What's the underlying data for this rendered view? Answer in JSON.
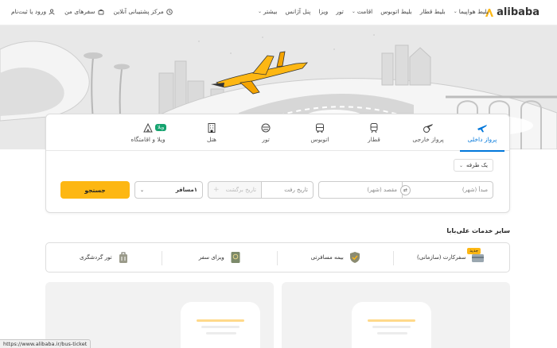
{
  "header": {
    "brand": "alibaba",
    "nav": [
      {
        "label": "بلیط هواپیما",
        "dropdown": true
      },
      {
        "label": "بلیط قطار",
        "dropdown": false
      },
      {
        "label": "بلیط اتوبوس",
        "dropdown": false
      },
      {
        "label": "اقامت",
        "dropdown": true
      },
      {
        "label": "تور",
        "dropdown": false
      },
      {
        "label": "ویزا",
        "dropdown": false
      },
      {
        "label": "پنل آژانس",
        "dropdown": false
      },
      {
        "label": "بیشتر",
        "dropdown": true
      }
    ],
    "support": "مرکز پشتیبانی آنلاین",
    "my_trips": "سفرهای من",
    "login": "ورود یا ثبت‌نام"
  },
  "tabs": [
    {
      "label": "پرواز داخلی",
      "icon": "plane-icon",
      "active": true
    },
    {
      "label": "پرواز خارجی",
      "icon": "globe-plane-icon",
      "active": false
    },
    {
      "label": "قطار",
      "icon": "train-icon",
      "active": false
    },
    {
      "label": "اتوبوس",
      "icon": "bus-icon",
      "active": false
    },
    {
      "label": "تور",
      "icon": "tour-icon",
      "active": false
    },
    {
      "label": "هتل",
      "icon": "hotel-icon",
      "active": false
    },
    {
      "label": "ویلا و اقامتگاه",
      "icon": "villa-icon",
      "active": false,
      "badge": "ویلا"
    }
  ],
  "search": {
    "trip_type": "یک طرفه",
    "origin_placeholder": "مبدأ (شهر)",
    "destination_placeholder": "مقصد (شهر)",
    "depart_placeholder": "تاریخ رفت",
    "return_placeholder": "تاریخ برگشت",
    "passengers_value": "۱مسافر",
    "submit": "جستجو"
  },
  "services": {
    "title": "سایر خدمات علی‌بابا",
    "items": [
      {
        "label": "سفرکارت (سازمانی)",
        "icon": "card-icon",
        "badge": "جدید"
      },
      {
        "label": "بیمه مسافرتی",
        "icon": "shield-icon"
      },
      {
        "label": "ویزای سفر",
        "icon": "passport-icon"
      },
      {
        "label": "تور گردشگری",
        "icon": "luggage-icon"
      }
    ]
  },
  "status_bar": "https://www.alibaba.ir/bus-ticket",
  "colors": {
    "accent": "#fdb713",
    "active_tab": "#0077db",
    "badge_green": "#15a36f"
  }
}
